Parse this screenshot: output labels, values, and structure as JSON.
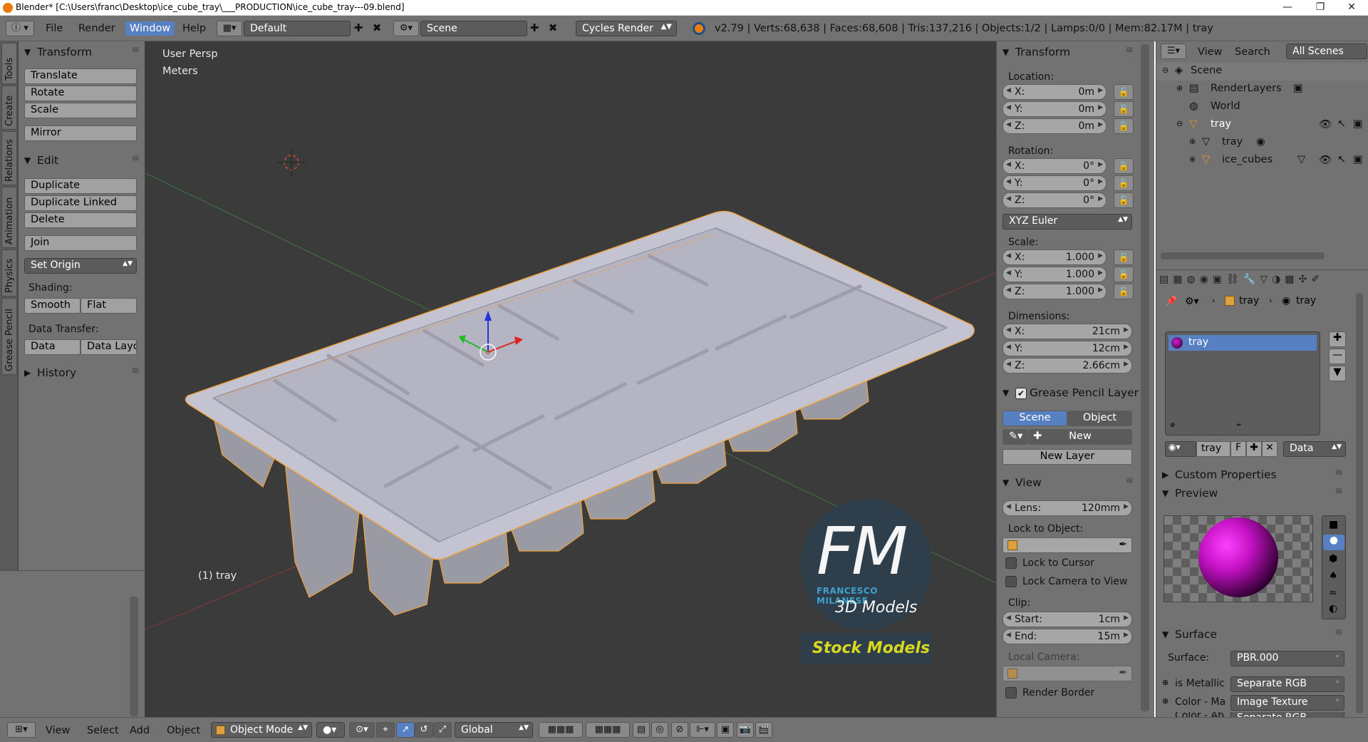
{
  "window": {
    "title": "Blender* [C:\\Users\\franc\\Desktop\\ice_cube_tray\\___PRODUCTION\\ice_cube_tray---09.blend]",
    "minimize": "—",
    "maximize": "❐",
    "close": "✕"
  },
  "header": {
    "menus": [
      "File",
      "Render",
      "Window",
      "Help"
    ],
    "active_menu": "Window",
    "screen_layout": "Default",
    "scene": "Scene",
    "render_engine": "Cycles Render",
    "stats": "v2.79 | Verts:68,638 | Faces:68,608 | Tris:137,216 | Objects:1/2 | Lamps:0/0 | Mem:82.17M | tray"
  },
  "tabs": [
    "Tools",
    "Create",
    "Relations",
    "Animation",
    "Physics",
    "Grease Pencil"
  ],
  "toolshelf": {
    "transform": {
      "title": "Transform",
      "buttons": [
        "Translate",
        "Rotate",
        "Scale",
        "Mirror"
      ]
    },
    "edit": {
      "title": "Edit",
      "buttons": [
        "Duplicate",
        "Duplicate Linked",
        "Delete",
        "Join"
      ],
      "set_origin": "Set Origin"
    },
    "shading": {
      "label": "Shading:",
      "smooth": "Smooth",
      "flat": "Flat"
    },
    "data_transfer": {
      "label": "Data Transfer:",
      "data": "Data",
      "data_layout": "Data Layo"
    },
    "history": {
      "title": "History"
    }
  },
  "viewport": {
    "view_name": "User Persp",
    "units": "Meters",
    "object_label": "(1) tray",
    "watermark": {
      "initials": "FM",
      "name": "FRANCESCO MILANESE",
      "tagline": "3D Models",
      "banner": "Stock Models"
    }
  },
  "npanel": {
    "transform_title": "Transform",
    "location_label": "Location:",
    "location": [
      {
        "axis": "X:",
        "value": "0m"
      },
      {
        "axis": "Y:",
        "value": "0m"
      },
      {
        "axis": "Z:",
        "value": "0m"
      }
    ],
    "rotation_label": "Rotation:",
    "rotation": [
      {
        "axis": "X:",
        "value": "0°"
      },
      {
        "axis": "Y:",
        "value": "0°"
      },
      {
        "axis": "Z:",
        "value": "0°"
      }
    ],
    "rotation_mode": "XYZ Euler",
    "scale_label": "Scale:",
    "scale": [
      {
        "axis": "X:",
        "value": "1.000"
      },
      {
        "axis": "Y:",
        "value": "1.000"
      },
      {
        "axis": "Z:",
        "value": "1.000"
      }
    ],
    "dimensions_label": "Dimensions:",
    "dimensions": [
      {
        "axis": "X:",
        "value": "21cm"
      },
      {
        "axis": "Y:",
        "value": "12cm"
      },
      {
        "axis": "Z:",
        "value": "2.66cm"
      }
    ],
    "grease_title": "Grease Pencil Layer",
    "grease_scene": "Scene",
    "grease_object": "Object",
    "grease_new": "New",
    "grease_new_layer": "New Layer",
    "view_title": "View",
    "lens_label": "Lens:",
    "lens_value": "120mm",
    "lock_object_label": "Lock to Object:",
    "lock_cursor": "Lock to Cursor",
    "lock_camera": "Lock Camera to View",
    "clip_label": "Clip:",
    "clip_start_label": "Start:",
    "clip_start": "1cm",
    "clip_end_label": "End:",
    "clip_end": "15m",
    "local_camera_label": "Local Camera:",
    "render_border": "Render Border"
  },
  "outliner": {
    "view": "View",
    "search": "Search",
    "filter": "All Scenes",
    "items": [
      {
        "name": "Scene"
      },
      {
        "name": "RenderLayers"
      },
      {
        "name": "World"
      },
      {
        "name": "tray"
      },
      {
        "name": "tray"
      },
      {
        "name": "ice_cubes"
      }
    ]
  },
  "properties": {
    "breadcrumb_object": "tray",
    "breadcrumb_material": "tray",
    "material_slot": "tray",
    "material_name": "tray",
    "material_f": "F",
    "link_mode": "Data",
    "custom_properties": "Custom Properties",
    "preview": "Preview",
    "surface_title": "Surface",
    "surface_label": "Surface:",
    "surface_value": "PBR.000",
    "is_metallic_label": "is Metallic",
    "is_metallic_value": "Separate RGB",
    "color_label": "Color - Ma",
    "color_value": "Image Texture",
    "color_ab_label": "Color - Ab",
    "color_ab_value": "Separate RGB"
  },
  "bottombar": {
    "view": "View",
    "select": "Select",
    "add": "Add",
    "object": "Object",
    "mode": "Object Mode",
    "orientation": "Global"
  },
  "colors": {
    "accent": "#5680c2",
    "selection_outline": "#f2a33a",
    "panel": "#727272",
    "viewport": "#3b3b3b"
  }
}
